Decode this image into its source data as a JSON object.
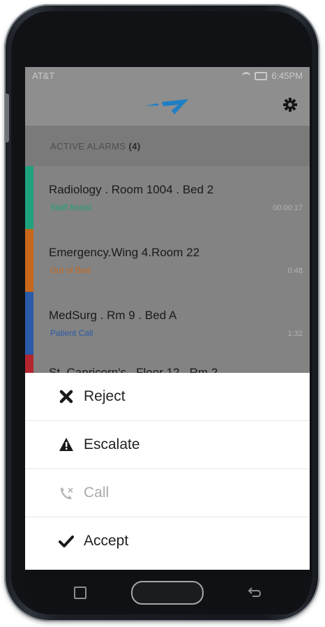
{
  "status_bar": {
    "carrier": "AT&T",
    "time": "6:45PM"
  },
  "app_bar": {
    "logo_icon": "brand-logo",
    "settings_icon": "gear-icon"
  },
  "alarms": {
    "header_label": "ACTIVE ALARMS",
    "count": "(4)",
    "items": [
      {
        "title": "Radiology . Room 1004 . Bed 2",
        "type": "Staff Assist",
        "elapsed": "00:00:17",
        "color": "#1fa27e"
      },
      {
        "title": "Emergency.Wing 4.Room 22",
        "type": "Out of Bed",
        "elapsed": "0:48",
        "color": "#c8681c"
      },
      {
        "title": "MedSurg . Rm 9 . Bed A",
        "type": "Patient Call",
        "elapsed": "1:32",
        "color": "#2a5aa8"
      },
      {
        "title": "St. Capricorn's . Floor 12 . Rm 2",
        "type": "",
        "elapsed": "",
        "color": "#b3262d"
      }
    ]
  },
  "actions": [
    {
      "label": "Reject",
      "icon": "close-icon",
      "enabled": true
    },
    {
      "label": "Escalate",
      "icon": "warning-icon",
      "enabled": true
    },
    {
      "label": "Call",
      "icon": "phone-icon",
      "enabled": false
    },
    {
      "label": "Accept",
      "icon": "check-icon",
      "enabled": true
    }
  ],
  "colors": {
    "accent": "#1f7fc4",
    "staff_assist": "#1fa27e",
    "out_of_bed": "#c8681c",
    "patient_call": "#2a5aa8",
    "critical": "#b3262d"
  }
}
